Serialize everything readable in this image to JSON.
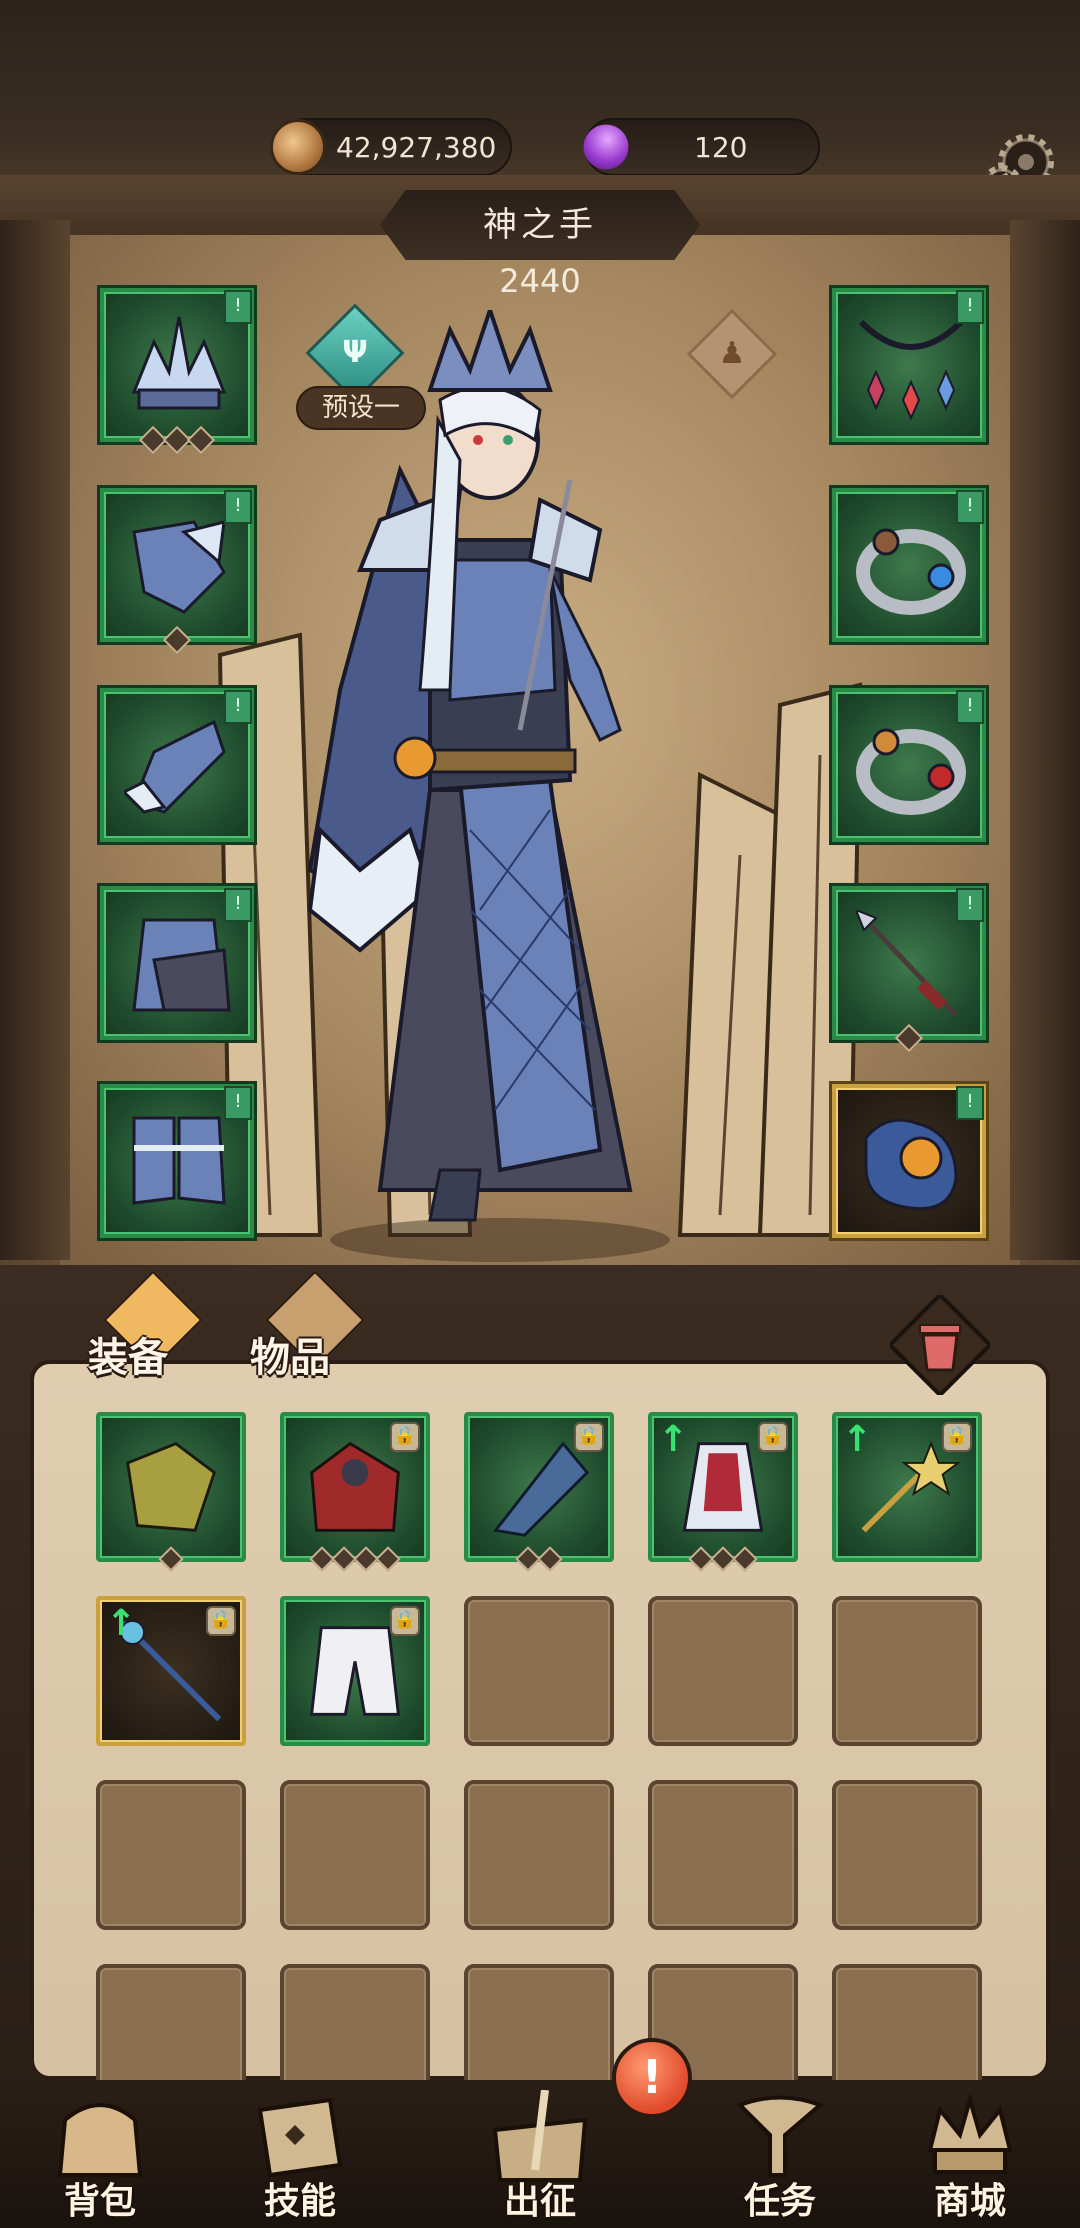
{
  "header": {
    "gold_amount": "42,927,380",
    "gem_amount": "120"
  },
  "hero": {
    "name": "神之手",
    "power": "2440",
    "preset_label": "预设一"
  },
  "equipment": {
    "left_slots": [
      "helmet",
      "shoulder-armor",
      "gauntlet",
      "leg-armor",
      "boots"
    ],
    "right_slots": [
      "necklace",
      "ring-sapphire",
      "ring-ruby",
      "spear-weapon",
      "orb-offhand"
    ]
  },
  "inventory": {
    "tabs": [
      {
        "label": "装备"
      },
      {
        "label": "物品"
      }
    ],
    "rows": 4,
    "cols": 5,
    "items": [
      {
        "name": "golden-armor-item",
        "locked": false,
        "upgrade": false,
        "gold": false,
        "pips": 1
      },
      {
        "name": "red-cloak-item",
        "locked": true,
        "upgrade": false,
        "gold": false,
        "pips": 4
      },
      {
        "name": "ice-cape-item",
        "locked": true,
        "upgrade": false,
        "gold": false,
        "pips": 2
      },
      {
        "name": "royal-dress-item",
        "locked": true,
        "upgrade": true,
        "gold": false,
        "pips": 3
      },
      {
        "name": "star-wand-item",
        "locked": true,
        "upgrade": true,
        "gold": false,
        "pips": 0
      },
      {
        "name": "blue-staff-item",
        "locked": true,
        "upgrade": true,
        "gold": true,
        "pips": 0
      },
      {
        "name": "white-pants-item",
        "locked": true,
        "upgrade": false,
        "gold": false,
        "pips": 0
      }
    ]
  },
  "nav": {
    "items": [
      {
        "label": "背包",
        "icon": "backpack-icon"
      },
      {
        "label": "技能",
        "icon": "skill-book-icon"
      },
      {
        "label": "出征",
        "icon": "expedition-sword-icon"
      },
      {
        "label": "任务",
        "icon": "quest-scroll-icon"
      },
      {
        "label": "商城",
        "icon": "shop-crown-icon"
      }
    ],
    "alert_text": "!"
  },
  "colors": {
    "slot_green": "#2a8a48",
    "slot_gold": "#c8a040",
    "panel_bg": "#d6c2a2",
    "alert_red": "#e04a2a"
  }
}
